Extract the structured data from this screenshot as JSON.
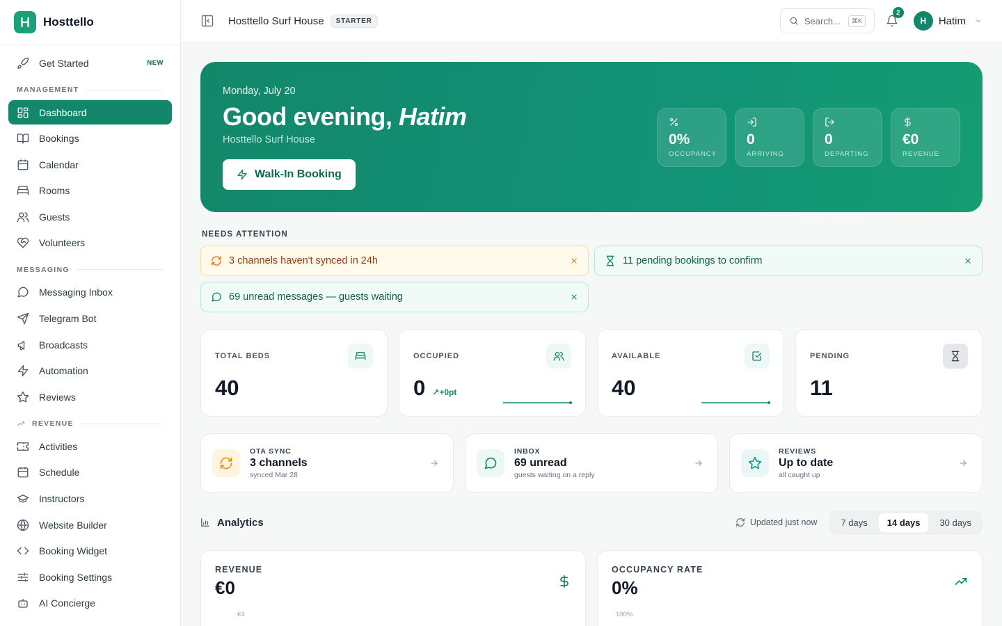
{
  "brand": {
    "name": "Hosttello"
  },
  "sidebar": {
    "get_started": {
      "label": "Get Started",
      "badge": "NEW"
    },
    "sections": {
      "management": "MANAGEMENT",
      "messaging": "MESSAGING",
      "revenue": "REVENUE"
    },
    "management_items": [
      {
        "label": "Dashboard",
        "icon": "dashboard-icon",
        "active": true
      },
      {
        "label": "Bookings",
        "icon": "book-open-icon"
      },
      {
        "label": "Calendar",
        "icon": "calendar-icon"
      },
      {
        "label": "Rooms",
        "icon": "bed-icon"
      },
      {
        "label": "Guests",
        "icon": "users-icon"
      },
      {
        "label": "Volunteers",
        "icon": "heart-handshake-icon"
      }
    ],
    "messaging_items": [
      {
        "label": "Messaging Inbox",
        "icon": "message-circle-icon"
      },
      {
        "label": "Telegram Bot",
        "icon": "send-icon"
      },
      {
        "label": "Broadcasts",
        "icon": "megaphone-icon"
      },
      {
        "label": "Automation",
        "icon": "zap-icon"
      },
      {
        "label": "Reviews",
        "icon": "star-icon"
      }
    ],
    "revenue_items": [
      {
        "label": "Activities",
        "icon": "ticket-icon"
      },
      {
        "label": "Schedule",
        "icon": "calendar-icon"
      },
      {
        "label": "Instructors",
        "icon": "graduation-cap-icon"
      },
      {
        "label": "Website Builder",
        "icon": "globe-icon"
      },
      {
        "label": "Booking Widget",
        "icon": "code-icon"
      },
      {
        "label": "Booking Settings",
        "icon": "sliders-icon"
      },
      {
        "label": "AI Concierge",
        "icon": "bot-icon"
      }
    ]
  },
  "topbar": {
    "property": "Hosttello Surf House",
    "plan": "STARTER",
    "search_placeholder": "Search...",
    "search_shortcut": "⌘K",
    "notifications": "2",
    "user_initial": "H",
    "user_name": "Hatim"
  },
  "hero": {
    "date": "Monday, July 20",
    "greeting": "Good evening, ",
    "name": "Hatim",
    "property": "Hosttello Surf House",
    "cta": "Walk-In Booking",
    "stats": [
      {
        "value": "0%",
        "label": "OCCUPANCY",
        "icon": "percent-icon"
      },
      {
        "value": "0",
        "label": "ARRIVING",
        "icon": "log-in-icon"
      },
      {
        "value": "0",
        "label": "DEPARTING",
        "icon": "log-out-icon"
      },
      {
        "value": "€0",
        "label": "REVENUE",
        "icon": "dollar-icon"
      }
    ]
  },
  "attention": {
    "label": "NEEDS ATTENTION",
    "alerts": [
      {
        "text": "3 channels haven't synced in 24h",
        "type": "warn"
      },
      {
        "text": "11 pending bookings to confirm",
        "type": "info"
      },
      {
        "text": "69 unread messages — guests waiting",
        "type": "info"
      }
    ]
  },
  "kpis": [
    {
      "label": "TOTAL BEDS",
      "value": "40"
    },
    {
      "label": "OCCUPIED",
      "value": "0",
      "trend": "+0pt"
    },
    {
      "label": "AVAILABLE",
      "value": "40"
    },
    {
      "label": "PENDING",
      "value": "11"
    }
  ],
  "quick": [
    {
      "kicker": "OTA SYNC",
      "title": "3 channels",
      "sub": "synced Mar 28"
    },
    {
      "kicker": "INBOX",
      "title": "69 unread",
      "sub": "guests waiting on a reply"
    },
    {
      "kicker": "REVIEWS",
      "title": "Up to date",
      "sub": "all caught up"
    }
  ],
  "analytics": {
    "title": "Analytics",
    "updated": "Updated just now",
    "ranges": [
      "7 days",
      "14 days",
      "30 days"
    ],
    "selected_range": "14 days",
    "cards": [
      {
        "label": "REVENUE",
        "value": "€0",
        "tick": "€4"
      },
      {
        "label": "OCCUPANCY RATE",
        "value": "0%",
        "tick": "100%"
      }
    ]
  },
  "colors": {
    "accent": "#13876a",
    "warn": "#d97706"
  }
}
